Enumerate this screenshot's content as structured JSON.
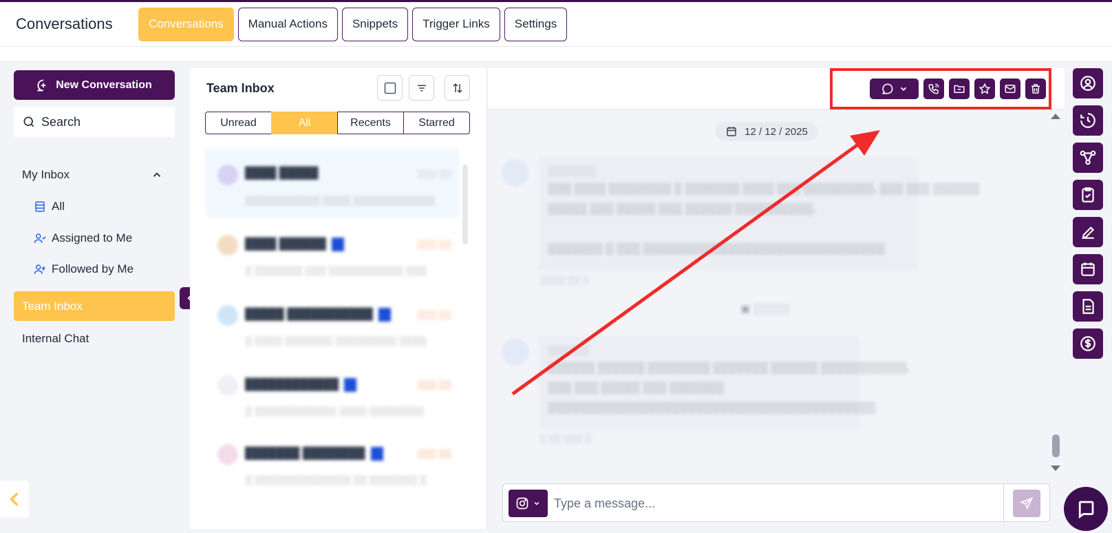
{
  "header": {
    "app_title": "Conversations",
    "tabs": [
      {
        "label": "Conversations",
        "active": true
      },
      {
        "label": "Manual Actions",
        "active": false
      },
      {
        "label": "Snippets",
        "active": false
      },
      {
        "label": "Trigger Links",
        "active": false
      },
      {
        "label": "Settings",
        "active": false
      }
    ]
  },
  "sidebar": {
    "new_conversation_label": "New Conversation",
    "search_label": "Search",
    "my_inbox_label": "My Inbox",
    "my_inbox_items": [
      {
        "label": "All",
        "icon": "inbox-icon"
      },
      {
        "label": "Assigned to Me",
        "icon": "user-assigned-icon"
      },
      {
        "label": "Followed by Me",
        "icon": "user-followed-icon"
      }
    ],
    "team_inbox_label": "Team Inbox",
    "internal_chat_label": "Internal Chat"
  },
  "list": {
    "title": "Team Inbox",
    "filters": [
      {
        "label": "Unread",
        "active": false
      },
      {
        "label": "All",
        "active": true
      },
      {
        "label": "Recents",
        "active": false
      },
      {
        "label": "Starred",
        "active": false
      }
    ]
  },
  "chat": {
    "date_label": "12 / 12 / 2025",
    "composer_placeholder": "Type a message..."
  },
  "colors": {
    "brand": "#4a1259",
    "accent": "#ffc44d",
    "annotation": "#ef2b2b"
  }
}
